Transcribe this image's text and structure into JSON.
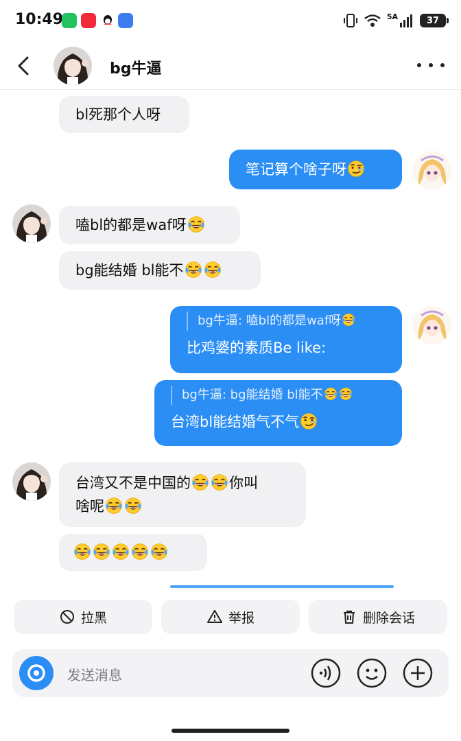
{
  "status_bar": {
    "time": "10:49",
    "battery": "37",
    "network": "5A"
  },
  "header": {
    "title": "bg牛逼"
  },
  "messages": [
    {
      "side": "in",
      "text": "bl死那个人呀"
    },
    {
      "side": "out",
      "text": "笔记算个啥子呀"
    },
    {
      "side": "in",
      "text": "嗑bl的都是waf呀"
    },
    {
      "side": "in",
      "text": "bg能结婚 bl能不"
    },
    {
      "side": "out",
      "quote": "bg牛逼: 嗑bl的都是waf呀",
      "text": "比鸡婆的素质Be like:"
    },
    {
      "side": "out",
      "quote": "bg牛逼: bg能结婚 bl能不",
      "text": "台湾bl能结婚气不气"
    },
    {
      "side": "in",
      "text_line1_a": "台湾又不是中国的",
      "text_line1_b": "你叫",
      "text_line2": "啥呢"
    },
    {
      "side": "in",
      "text": ""
    }
  ],
  "actions": {
    "block": "拉黑",
    "report": "举报",
    "delete": "删除会话"
  },
  "input": {
    "placeholder": "发送消息"
  },
  "colors": {
    "accent": "#2a8ef5",
    "incoming_bubble": "#f1f1f3"
  },
  "icons": [
    "back-icon",
    "more-icon",
    "ban-icon",
    "warning-icon",
    "trash-icon",
    "camera-icon",
    "voice-icon",
    "emoji-icon",
    "plus-icon",
    "laugh-cry-emoji",
    "smirk-emoji"
  ]
}
